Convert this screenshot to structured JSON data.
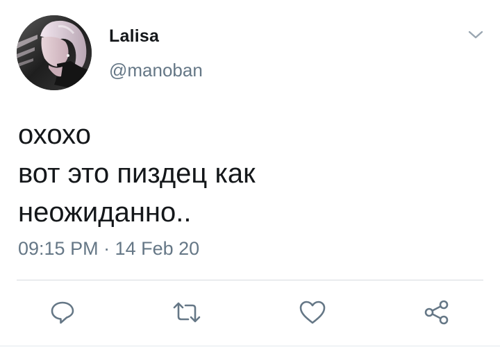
{
  "tweet": {
    "display_name": "Lalisa",
    "handle": "@manoban",
    "text_lines": [
      "охохо",
      "вот это пиздец как",
      "неожиданно.."
    ],
    "timestamp": "09:15 PM · 14 Feb 20"
  },
  "actions": {
    "reply_icon": "reply-icon",
    "retweet_icon": "retweet-icon",
    "like_icon": "heart-icon",
    "share_icon": "share-icon"
  },
  "colors": {
    "text_primary": "#14171a",
    "text_secondary": "#657786",
    "icon_color": "#657786",
    "divider": "#d5dade",
    "background": "#ffffff"
  }
}
